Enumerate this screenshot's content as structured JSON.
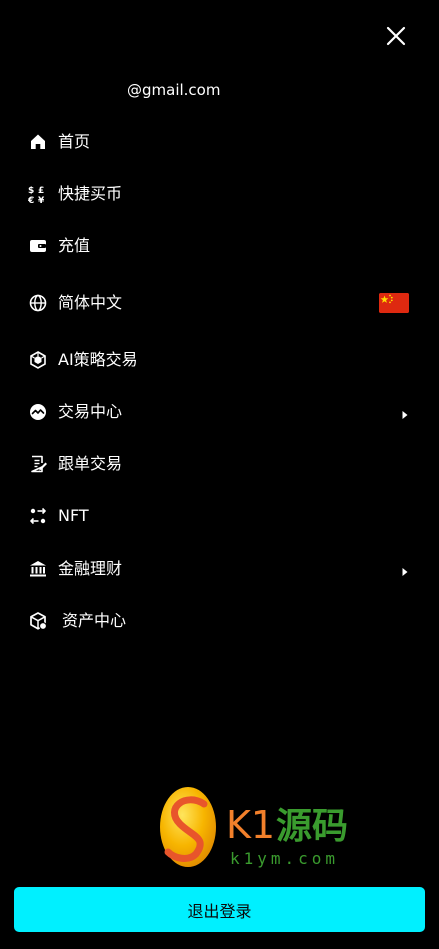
{
  "header": {
    "close_icon": "close-icon",
    "email": "@gmail.com"
  },
  "menu": {
    "items": [
      {
        "label": "首页",
        "icon": "home-icon"
      },
      {
        "label": "快捷买币",
        "icon": "currency-exchange-icon"
      },
      {
        "label": "充值",
        "icon": "wallet-icon"
      },
      {
        "label": "简体中文",
        "icon": "globe-icon",
        "flag": "china-flag-icon"
      },
      {
        "label": "AI策略交易",
        "icon": "ai-cube-icon"
      },
      {
        "label": "交易中心",
        "icon": "trade-chart-icon",
        "has_submenu": true
      },
      {
        "label": "跟单交易",
        "icon": "copy-trade-document-icon"
      },
      {
        "label": "NFT",
        "icon": "nft-swap-icon"
      },
      {
        "label": "金融理财",
        "icon": "bank-icon",
        "has_submenu": true
      },
      {
        "label": "资产中心",
        "icon": "assets-box-icon"
      }
    ]
  },
  "watermark": {
    "brand": "K1源码",
    "url": "k1ym.com"
  },
  "footer": {
    "logout_label": "退出登录"
  },
  "colors": {
    "background": "#000000",
    "text": "#ffffff",
    "accent": "#00f0ff",
    "flag_red": "#de2910",
    "flag_yellow": "#ffde00"
  }
}
